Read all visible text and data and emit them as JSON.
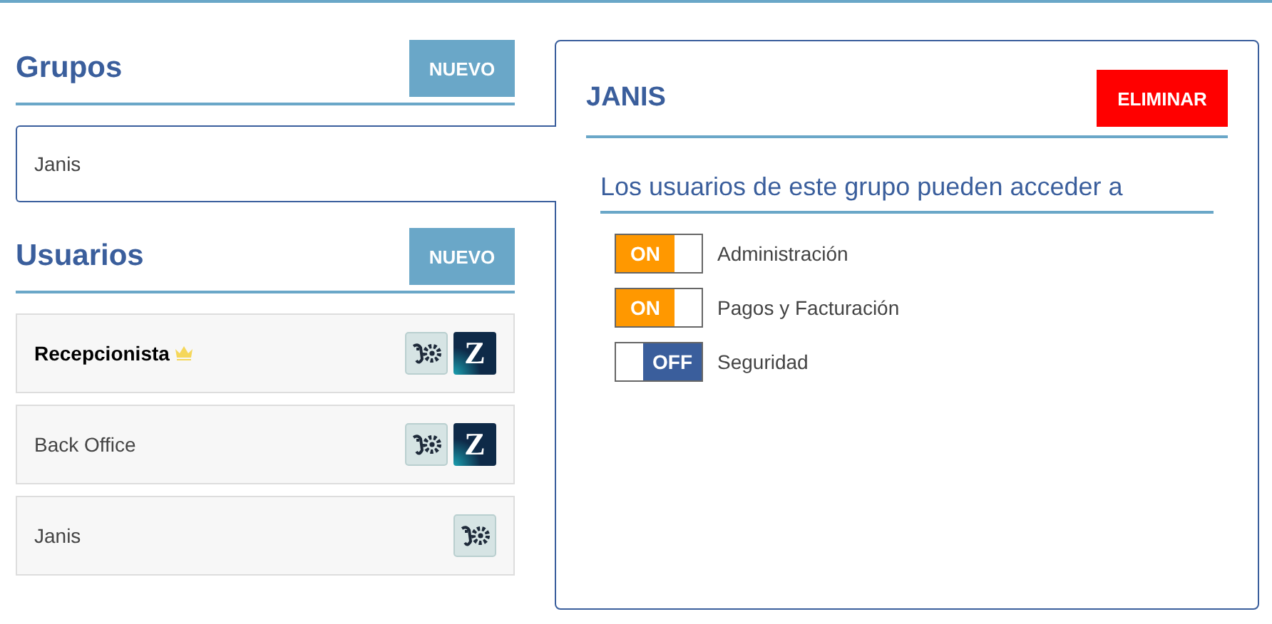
{
  "groups": {
    "title": "Grupos",
    "new_button": "NUEVO",
    "items": [
      {
        "name": "Janis",
        "selected": true
      }
    ]
  },
  "users": {
    "title": "Usuarios",
    "new_button": "NUEVO",
    "items": [
      {
        "name": "Recepcionista",
        "owner": true,
        "apps": [
          {
            "kind": "gear"
          },
          {
            "kind": "letter",
            "label": "Z"
          }
        ]
      },
      {
        "name": "Back Office",
        "owner": false,
        "apps": [
          {
            "kind": "gear"
          },
          {
            "kind": "letter",
            "label": "Z"
          }
        ]
      },
      {
        "name": "Janis",
        "owner": false,
        "apps": [
          {
            "kind": "gear"
          }
        ]
      }
    ]
  },
  "detail": {
    "title": "JANIS",
    "delete_button": "ELIMINAR",
    "subtitle": "Los usuarios de este grupo pueden acceder a",
    "permissions": [
      {
        "label": "Administración",
        "on": true,
        "switch_text": "ON"
      },
      {
        "label": "Pagos y Facturación",
        "on": true,
        "switch_text": "ON"
      },
      {
        "label": "Seguridad",
        "on": false,
        "switch_text": "OFF"
      }
    ]
  }
}
